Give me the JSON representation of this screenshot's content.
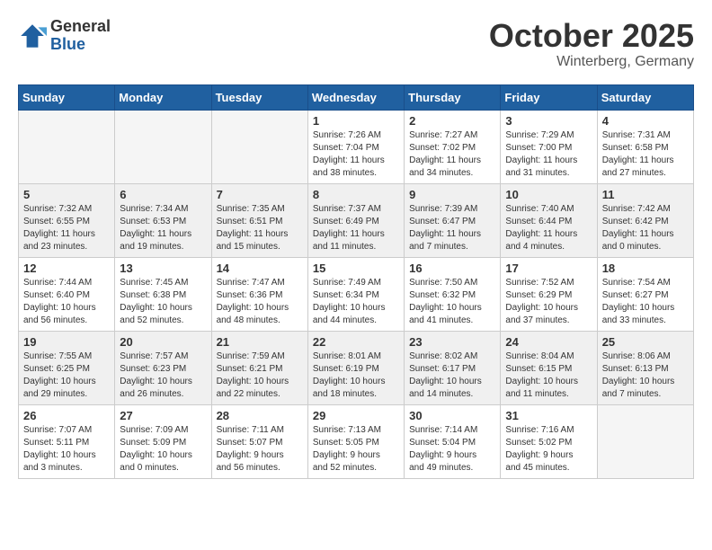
{
  "logo": {
    "general": "General",
    "blue": "Blue"
  },
  "title": "October 2025",
  "subtitle": "Winterberg, Germany",
  "weekdays": [
    "Sunday",
    "Monday",
    "Tuesday",
    "Wednesday",
    "Thursday",
    "Friday",
    "Saturday"
  ],
  "weeks": [
    [
      {
        "day": "",
        "info": ""
      },
      {
        "day": "",
        "info": ""
      },
      {
        "day": "",
        "info": ""
      },
      {
        "day": "1",
        "info": "Sunrise: 7:26 AM\nSunset: 7:04 PM\nDaylight: 11 hours\nand 38 minutes."
      },
      {
        "day": "2",
        "info": "Sunrise: 7:27 AM\nSunset: 7:02 PM\nDaylight: 11 hours\nand 34 minutes."
      },
      {
        "day": "3",
        "info": "Sunrise: 7:29 AM\nSunset: 7:00 PM\nDaylight: 11 hours\nand 31 minutes."
      },
      {
        "day": "4",
        "info": "Sunrise: 7:31 AM\nSunset: 6:58 PM\nDaylight: 11 hours\nand 27 minutes."
      }
    ],
    [
      {
        "day": "5",
        "info": "Sunrise: 7:32 AM\nSunset: 6:55 PM\nDaylight: 11 hours\nand 23 minutes."
      },
      {
        "day": "6",
        "info": "Sunrise: 7:34 AM\nSunset: 6:53 PM\nDaylight: 11 hours\nand 19 minutes."
      },
      {
        "day": "7",
        "info": "Sunrise: 7:35 AM\nSunset: 6:51 PM\nDaylight: 11 hours\nand 15 minutes."
      },
      {
        "day": "8",
        "info": "Sunrise: 7:37 AM\nSunset: 6:49 PM\nDaylight: 11 hours\nand 11 minutes."
      },
      {
        "day": "9",
        "info": "Sunrise: 7:39 AM\nSunset: 6:47 PM\nDaylight: 11 hours\nand 7 minutes."
      },
      {
        "day": "10",
        "info": "Sunrise: 7:40 AM\nSunset: 6:44 PM\nDaylight: 11 hours\nand 4 minutes."
      },
      {
        "day": "11",
        "info": "Sunrise: 7:42 AM\nSunset: 6:42 PM\nDaylight: 11 hours\nand 0 minutes."
      }
    ],
    [
      {
        "day": "12",
        "info": "Sunrise: 7:44 AM\nSunset: 6:40 PM\nDaylight: 10 hours\nand 56 minutes."
      },
      {
        "day": "13",
        "info": "Sunrise: 7:45 AM\nSunset: 6:38 PM\nDaylight: 10 hours\nand 52 minutes."
      },
      {
        "day": "14",
        "info": "Sunrise: 7:47 AM\nSunset: 6:36 PM\nDaylight: 10 hours\nand 48 minutes."
      },
      {
        "day": "15",
        "info": "Sunrise: 7:49 AM\nSunset: 6:34 PM\nDaylight: 10 hours\nand 44 minutes."
      },
      {
        "day": "16",
        "info": "Sunrise: 7:50 AM\nSunset: 6:32 PM\nDaylight: 10 hours\nand 41 minutes."
      },
      {
        "day": "17",
        "info": "Sunrise: 7:52 AM\nSunset: 6:29 PM\nDaylight: 10 hours\nand 37 minutes."
      },
      {
        "day": "18",
        "info": "Sunrise: 7:54 AM\nSunset: 6:27 PM\nDaylight: 10 hours\nand 33 minutes."
      }
    ],
    [
      {
        "day": "19",
        "info": "Sunrise: 7:55 AM\nSunset: 6:25 PM\nDaylight: 10 hours\nand 29 minutes."
      },
      {
        "day": "20",
        "info": "Sunrise: 7:57 AM\nSunset: 6:23 PM\nDaylight: 10 hours\nand 26 minutes."
      },
      {
        "day": "21",
        "info": "Sunrise: 7:59 AM\nSunset: 6:21 PM\nDaylight: 10 hours\nand 22 minutes."
      },
      {
        "day": "22",
        "info": "Sunrise: 8:01 AM\nSunset: 6:19 PM\nDaylight: 10 hours\nand 18 minutes."
      },
      {
        "day": "23",
        "info": "Sunrise: 8:02 AM\nSunset: 6:17 PM\nDaylight: 10 hours\nand 14 minutes."
      },
      {
        "day": "24",
        "info": "Sunrise: 8:04 AM\nSunset: 6:15 PM\nDaylight: 10 hours\nand 11 minutes."
      },
      {
        "day": "25",
        "info": "Sunrise: 8:06 AM\nSunset: 6:13 PM\nDaylight: 10 hours\nand 7 minutes."
      }
    ],
    [
      {
        "day": "26",
        "info": "Sunrise: 7:07 AM\nSunset: 5:11 PM\nDaylight: 10 hours\nand 3 minutes."
      },
      {
        "day": "27",
        "info": "Sunrise: 7:09 AM\nSunset: 5:09 PM\nDaylight: 10 hours\nand 0 minutes."
      },
      {
        "day": "28",
        "info": "Sunrise: 7:11 AM\nSunset: 5:07 PM\nDaylight: 9 hours\nand 56 minutes."
      },
      {
        "day": "29",
        "info": "Sunrise: 7:13 AM\nSunset: 5:05 PM\nDaylight: 9 hours\nand 52 minutes."
      },
      {
        "day": "30",
        "info": "Sunrise: 7:14 AM\nSunset: 5:04 PM\nDaylight: 9 hours\nand 49 minutes."
      },
      {
        "day": "31",
        "info": "Sunrise: 7:16 AM\nSunset: 5:02 PM\nDaylight: 9 hours\nand 45 minutes."
      },
      {
        "day": "",
        "info": ""
      }
    ]
  ]
}
